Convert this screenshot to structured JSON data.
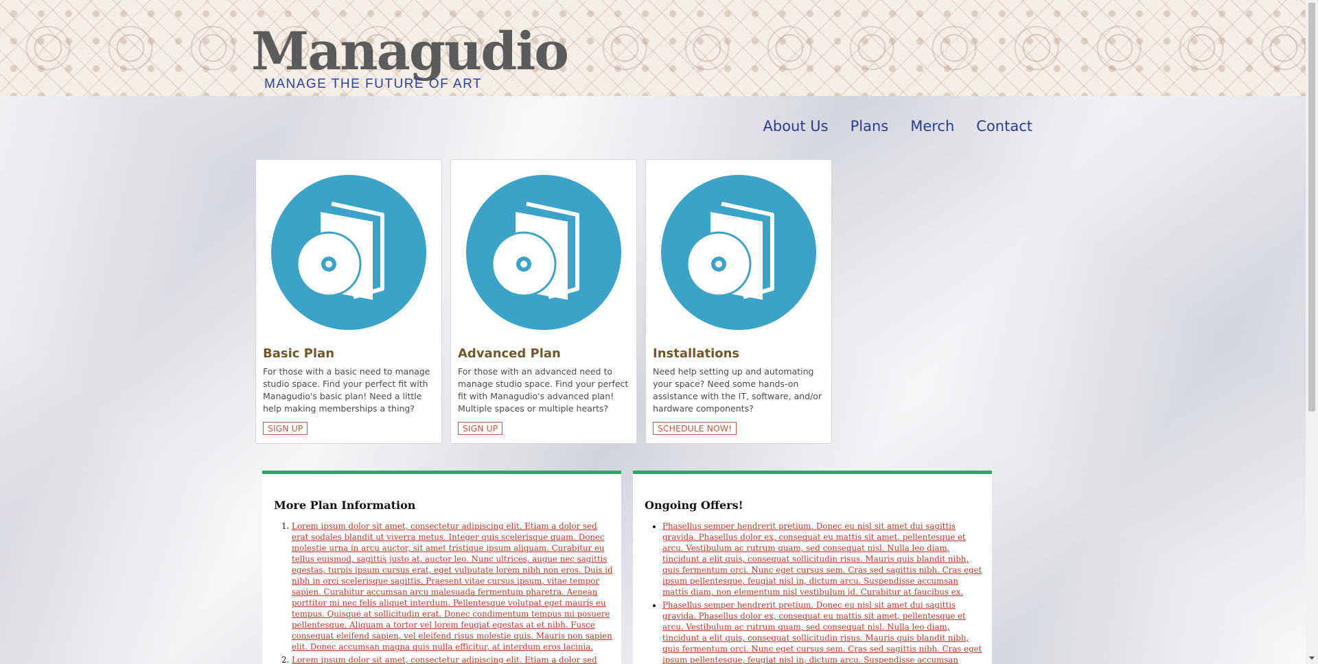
{
  "brand": {
    "name": "Managudio",
    "tagline": "MANAGE THE FUTURE OF ART"
  },
  "nav": {
    "items": [
      "About Us",
      "Plans",
      "Merch",
      "Contact"
    ]
  },
  "cards": [
    {
      "icon": "disc-book-icon",
      "title": "Basic Plan",
      "text": "For those with a basic need to manage studio space. Find your perfect fit with Managudio's basic plan! Need a little help making memberships a thing?",
      "button": "SIGN UP"
    },
    {
      "icon": "disc-book-icon",
      "title": "Advanced Plan",
      "text": "For those with an advanced need to manage studio space. Find your perfect fit with Managudio's advanced plan! Multiple spaces or multiple hearts?",
      "button": "SIGN UP"
    },
    {
      "icon": "disc-book-icon",
      "title": "Installations",
      "text": "Need help setting up and automating your space? Need some hands-on assistance with the IT, software, and/or hardware components?",
      "button": "SCHEDULE NOW!"
    }
  ],
  "plan_info": {
    "title": "More Plan Information",
    "items": [
      "Lorem ipsum dolor sit amet, consectetur adipiscing elit. Etiam a dolor sed erat sodales blandit ut viverra metus. Integer quis scelerisque quam. Donec molestie urna in arcu auctor, sit amet tristique ipsum aliquam. Curabitur eu tellus euismod, sagittis justo at, auctor leo. Nunc ultrices, augue nec sagittis egestas, turpis ipsum cursus erat, eget vulputate lorem nibh non eros. Duis id nibh in orci scelerisque sagittis. Praesent vitae cursus ipsum, vitae tempor sapien. Curabitur accumsan arcu malesuada fermentum pharetra. Aenean porttitor mi nec felis aliquet interdum. Pellentesque volutpat eget mauris eu tempus. Quisque at sollicitudin erat. Donec condimentum tempus mi posuere pellentesque. Aliquam a tortor vel lorem feugiat egestas at et nibh. Fusce consequat eleifend sapien, vel eleifend risus molestie quis. Mauris non sapien elit. Donec accumsan magna quis nulla efficitur, at interdum eros lacinia.",
      "Lorem ipsum dolor sit amet, consectetur adipiscing elit. Etiam a dolor sed erat"
    ]
  },
  "offers": {
    "title": "Ongoing Offers!",
    "items": [
      "Phasellus semper hendrerit pretium. Donec eu nisl sit amet dui sagittis gravida. Phasellus dolor ex, consequat eu mattis sit amet, pellentesque et arcu. Vestibulum ac rutrum quam, sed consequat nisl. Nulla leo diam, tincidunt a elit quis, consequat sollicitudin risus. Mauris quis blandit nibh, quis fermentum orci. Nunc eget cursus sem. Cras sed sagittis nibh. Cras eget ipsum pellentesque, feugiat nisl in, dictum arcu. Suspendisse accumsan mattis diam, non elementum nisl vestibulum id. Curabitur at faucibus ex.",
      "Phasellus semper hendrerit pretium. Donec eu nisl sit amet dui sagittis gravida. Phasellus dolor ex, consequat eu mattis sit amet, pellentesque et arcu. Vestibulum ac rutrum quam, sed consequat nisl. Nulla leo diam, tincidunt a elit quis, consequat sollicitudin risus. Mauris quis blandit nibh, quis fermentum orci. Nunc eget cursus sem. Cras sed sagittis nibh. Cras eget ipsum pellentesque, feugiat nisl in, dictum arcu. Suspendisse accumsan mattis diam, non elementum nisl"
    ]
  },
  "colors": {
    "icon_circle": "#3aa3c7",
    "card_title": "#70582a",
    "button_border": "#c0584a",
    "panel_accent": "#2ea563",
    "link": "#c0392b",
    "nav": "#2e3a8e",
    "tagline": "#2e3f99"
  }
}
